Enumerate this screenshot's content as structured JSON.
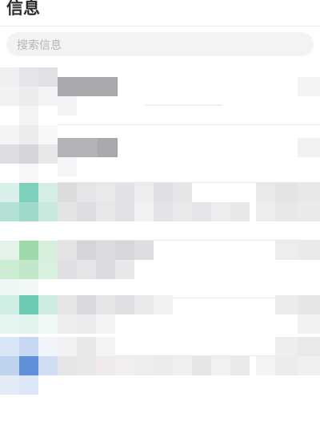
{
  "header": {
    "title": "信息"
  },
  "search": {
    "placeholder": "搜索信息"
  },
  "conversations": [
    {
      "avatar_color": "#e6e6ea",
      "state": "pixelated"
    },
    {
      "avatar_color": "#e4e4e8",
      "state": "pixelated"
    },
    {
      "avatar_color": "#7fcfbd",
      "state": "pixelated"
    },
    {
      "avatar_color": "#9fd8ab",
      "state": "pixelated"
    },
    {
      "avatar_color": "#6bc9b4",
      "state": "pixelated"
    },
    {
      "avatar_color": "#5f8fd6",
      "state": "pixelated"
    }
  ]
}
